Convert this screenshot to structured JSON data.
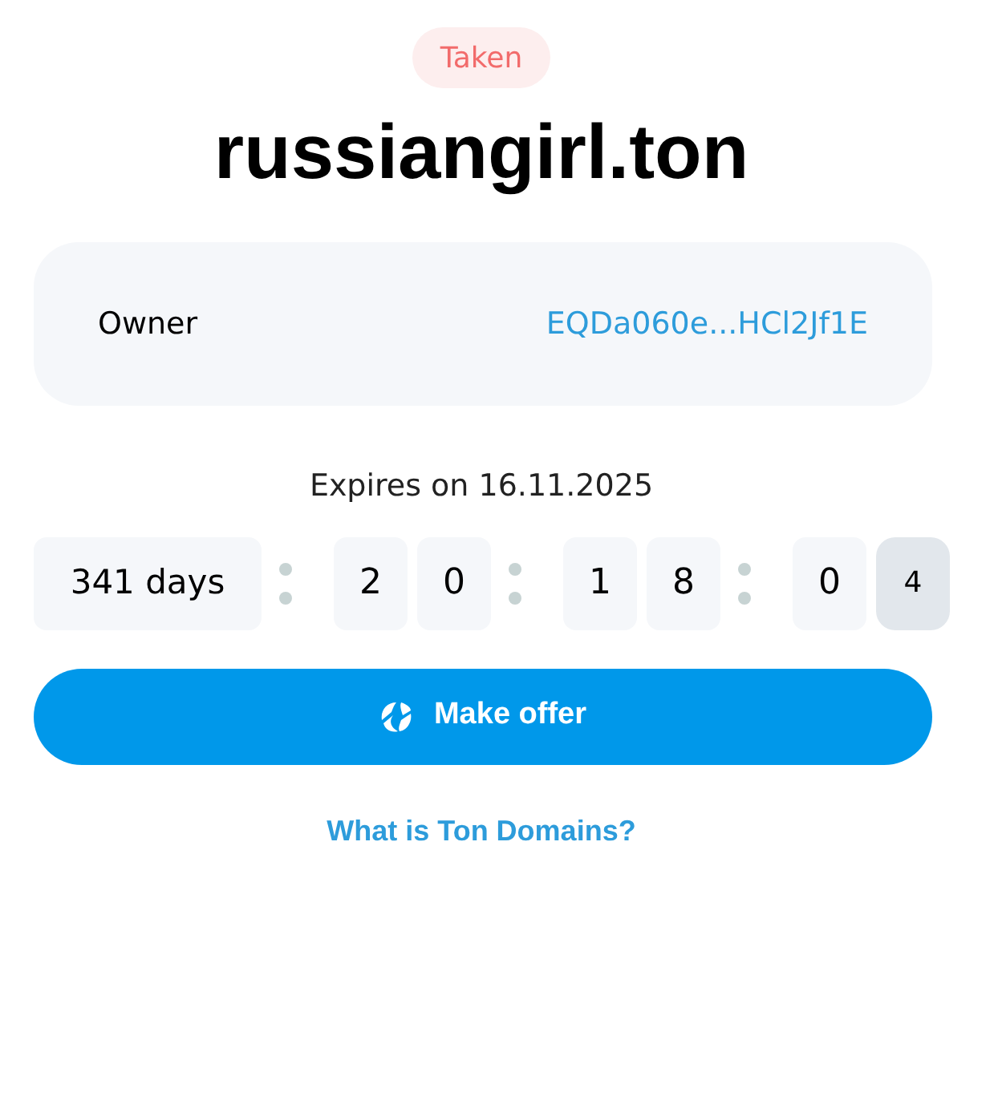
{
  "status_badge": "Taken",
  "domain": "russiangirl.ton",
  "owner": {
    "label": "Owner",
    "address": "EQDa060e...HCl2Jf1E"
  },
  "expires": "Expires on 16.11.2025",
  "countdown": {
    "days": "341 days",
    "groups": [
      {
        "digits": [
          {
            "value": "2",
            "flipping": false
          },
          {
            "value": "0",
            "flipping": false
          }
        ]
      },
      {
        "digits": [
          {
            "value": "1",
            "flipping": false
          },
          {
            "value": "8",
            "flipping": false
          }
        ]
      },
      {
        "digits": [
          {
            "value": "0",
            "flipping": false
          },
          {
            "value": "4",
            "flipping": true
          }
        ]
      }
    ]
  },
  "offer_button": "Make offer",
  "help_link": "What is Ton Domains?"
}
